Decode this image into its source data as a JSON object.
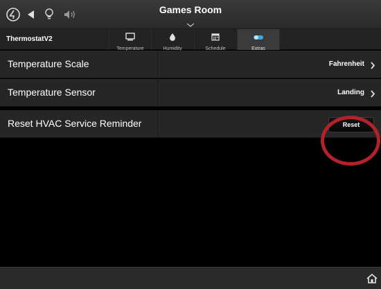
{
  "header": {
    "room_title": "Games Room",
    "icons": [
      "logo-icon",
      "back-icon",
      "lightbulb-icon",
      "volume-icon"
    ]
  },
  "device": {
    "name": "ThermostatV2"
  },
  "tabs": [
    {
      "label": "Temperature",
      "icon": "monitor-icon",
      "active": false
    },
    {
      "label": "Humidity",
      "icon": "droplet-icon",
      "active": false
    },
    {
      "label": "Schedule",
      "icon": "calendar-icon",
      "active": false
    },
    {
      "label": "Extras",
      "icon": "toggle-icon",
      "active": true
    }
  ],
  "settings": {
    "temperature_scale": {
      "label": "Temperature Scale",
      "value": "Fahrenheit"
    },
    "temperature_sensor": {
      "label": "Temperature Sensor",
      "value": "Landing"
    },
    "hvac_reminder": {
      "label": "Reset HVAC Service Reminder",
      "button_label": "Reset"
    }
  },
  "colors": {
    "highlight": "#b3222a",
    "active_tab_icon": "#3aa9e0"
  }
}
